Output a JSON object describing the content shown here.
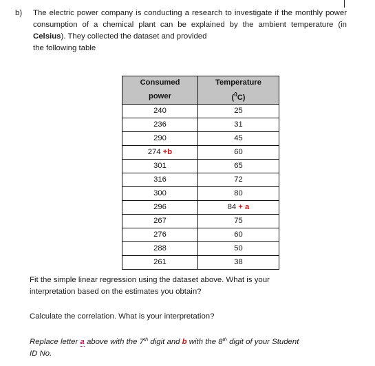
{
  "document": {
    "question_label": "b)",
    "question_text_main": "The electric power company is conducting a research to investigate if the monthly power consumption of a chemical plant can be explained by the ambient temperature (in ",
    "question_bold_term": "Celsius",
    "question_text_after": "). They collected the dataset and provided",
    "question_last_line": "the following table"
  },
  "table": {
    "headers": {
      "col1_line1": "Consumed",
      "col1_line2": "power",
      "col2_line1": "Temperature",
      "col2_line2_open": "(",
      "col2_line2_degree": "0",
      "col2_line2_close": "C)"
    },
    "rows": [
      {
        "power": "240",
        "power_var": "",
        "temp": "25",
        "temp_var": ""
      },
      {
        "power": "236",
        "power_var": "",
        "temp": "31",
        "temp_var": ""
      },
      {
        "power": "290",
        "power_var": "",
        "temp": "45",
        "temp_var": ""
      },
      {
        "power": "274",
        "power_var": "+b",
        "temp": "60",
        "temp_var": ""
      },
      {
        "power": "301",
        "power_var": "",
        "temp": "65",
        "temp_var": ""
      },
      {
        "power": "316",
        "power_var": "",
        "temp": "72",
        "temp_var": ""
      },
      {
        "power": "300",
        "power_var": "",
        "temp": "80",
        "temp_var": ""
      },
      {
        "power": "296",
        "power_var": "",
        "temp": "84",
        "temp_var": "+ a"
      },
      {
        "power": "267",
        "power_var": "",
        "temp": "75",
        "temp_var": ""
      },
      {
        "power": "276",
        "power_var": "",
        "temp": "60",
        "temp_var": ""
      },
      {
        "power": "288",
        "power_var": "",
        "temp": "50",
        "temp_var": ""
      },
      {
        "power": "261",
        "power_var": "",
        "temp": "38",
        "temp_var": ""
      }
    ]
  },
  "prompts": {
    "prompt1_line1": "Fit the simple linear regression using the dataset above. What is your",
    "prompt1_line2": "interpretation based on the estimates you obtain?",
    "prompt2": "Calculate the correlation. What is your interpretation?",
    "prompt3_part1": "Replace letter ",
    "prompt3_var_a": "a",
    "prompt3_part2": " above with the 7",
    "prompt3_ord1": "th",
    "prompt3_part3": " digit and ",
    "prompt3_var_b": "b",
    "prompt3_part4": " with the 8",
    "prompt3_ord2": "th",
    "prompt3_part5": " digit of your Student",
    "prompt3_line2": "ID No."
  },
  "colors": {
    "header_gray": "#c3c3c3",
    "variable_red": "#cc1111",
    "variable_a_magenta": "#c21f5b",
    "border": "#121212"
  },
  "chart_data": {
    "type": "table",
    "title": "Consumed power vs Temperature dataset",
    "columns": [
      "Consumed power",
      "Temperature (°C)"
    ],
    "x": [
      25,
      31,
      45,
      60,
      65,
      72,
      80,
      84,
      75,
      60,
      50,
      38
    ],
    "y": [
      240,
      236,
      290,
      274,
      301,
      316,
      300,
      296,
      267,
      276,
      288,
      261
    ],
    "xlabel": "Temperature (°C)",
    "ylabel": "Consumed power",
    "notes": [
      "Row 4 power value is 274 +b (b = 8th digit of Student ID No.)",
      "Row 8 temperature value is 84 + a (a = 7th digit of Student ID No.)"
    ]
  }
}
